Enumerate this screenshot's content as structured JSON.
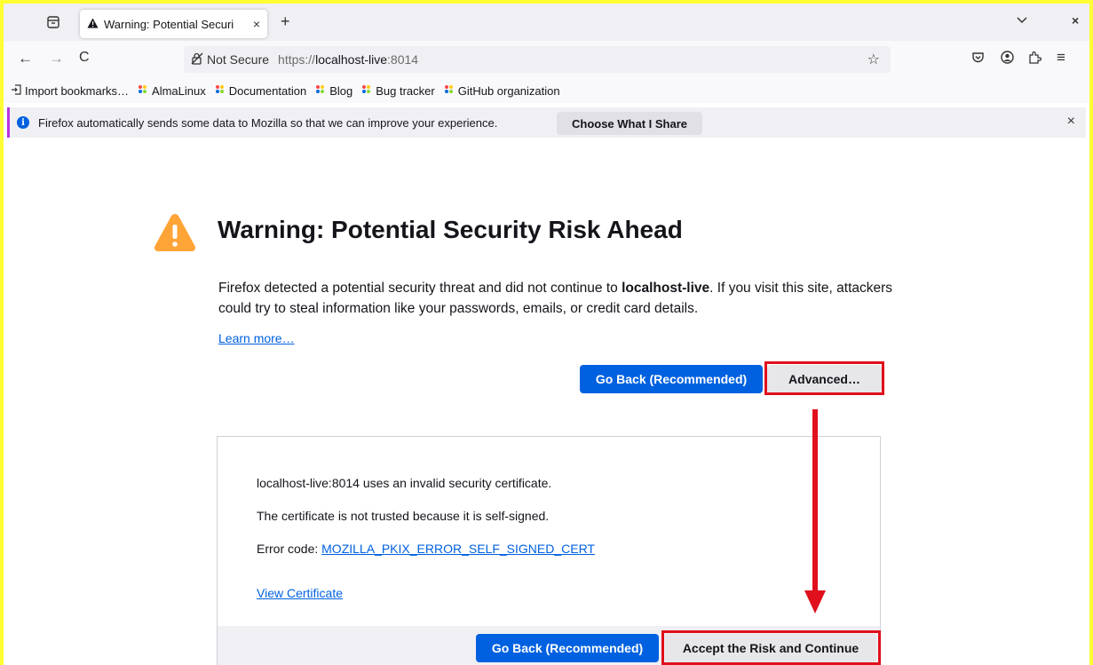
{
  "tab": {
    "title": "Warning: Potential Securi",
    "close": "×"
  },
  "tabstrip": {
    "new_tab": "+",
    "list_all": "⌄",
    "close_window": "×"
  },
  "nav": {
    "back": "←",
    "forward": "→",
    "reload": "C",
    "not_secure": "Not Secure",
    "url_scheme": "https://",
    "url_host": "localhost-live",
    "url_port": ":8014",
    "star": "☆",
    "menu": "≡"
  },
  "bookmarks": [
    {
      "label": "Import bookmarks…",
      "icon": "import-icon"
    },
    {
      "label": "AlmaLinux",
      "icon": "almalinux-icon"
    },
    {
      "label": "Documentation",
      "icon": "almalinux-icon"
    },
    {
      "label": "Blog",
      "icon": "almalinux-icon"
    },
    {
      "label": "Bug tracker",
      "icon": "almalinux-icon"
    },
    {
      "label": "GitHub organization",
      "icon": "almalinux-icon"
    }
  ],
  "notification": {
    "text": "Firefox automatically sends some data to Mozilla so that we can improve your experience.",
    "button": "Choose What I Share",
    "close": "×"
  },
  "page": {
    "title": "Warning: Potential Security Risk Ahead",
    "desc_part1": "Firefox detected a potential security threat and did not continue to ",
    "desc_host": "localhost-live",
    "desc_part2": ". If you visit this site, attackers could try to steal information like your passwords, emails, or credit card details.",
    "learn_more": "Learn more…",
    "go_back": "Go Back (Recommended)",
    "advanced": "Advanced…"
  },
  "advanced_panel": {
    "line1": "localhost-live:8014 uses an invalid security certificate.",
    "line2": "The certificate is not trusted because it is self-signed.",
    "error_prefix": "Error code: ",
    "error_code": "MOZILLA_PKIX_ERROR_SELF_SIGNED_CERT",
    "view_cert": "View Certificate",
    "go_back": "Go Back (Recommended)",
    "accept": "Accept the Risk and Continue"
  },
  "colors": {
    "accent": "#0061e0",
    "highlight": "#e0101c",
    "warning": "#ffa436",
    "border": "#ffff33"
  }
}
